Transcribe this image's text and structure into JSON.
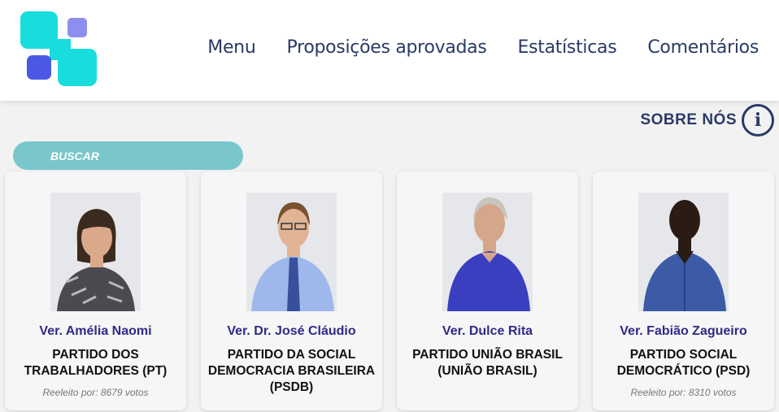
{
  "nav": {
    "items": [
      {
        "label": "Menu"
      },
      {
        "label": "Proposições aprovadas"
      },
      {
        "label": "Estatísticas"
      },
      {
        "label": "Comentários"
      }
    ]
  },
  "about": {
    "label": "SOBRE NÓS",
    "icon": "info-icon"
  },
  "search": {
    "placeholder": "BUSCAR"
  },
  "colors": {
    "accent": "#79c7cb",
    "nav_text": "#2a3a66",
    "name_text": "#2f2a86",
    "logo_cyan": "#19dcdd",
    "logo_blue": "#4a58e4",
    "logo_lavender": "#8d8fef"
  },
  "cards": [
    {
      "name": "Ver. Amélia Naomi",
      "party": "PARTIDO DOS TRABALHADORES (PT)",
      "votes": "Reeleito por: 8679 votos"
    },
    {
      "name": "Ver. Dr. José Cláudio",
      "party": "PARTIDO DA SOCIAL DEMOCRACIA BRASILEIRA (PSDB)",
      "votes": ""
    },
    {
      "name": "Ver. Dulce Rita",
      "party": "PARTIDO UNIÃO BRASIL (UNIÃO BRASIL)",
      "votes": ""
    },
    {
      "name": "Ver. Fabião Zagueiro",
      "party": "PARTIDO SOCIAL DEMOCRÁTICO (PSD)",
      "votes": "Reeleito por: 8310 votos"
    }
  ]
}
